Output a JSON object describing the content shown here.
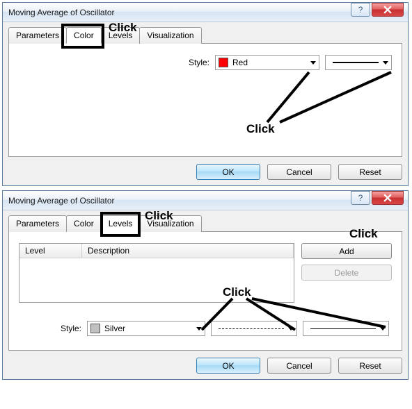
{
  "dialog1": {
    "title": "Moving Average of Oscillator",
    "tabs": {
      "parameters": "Parameters",
      "color": "Color",
      "levels": "Levels",
      "visualization": "Visualization"
    },
    "style_label": "Style:",
    "color_name": "Red",
    "color_hex": "#ff0000",
    "ok": "OK",
    "cancel": "Cancel",
    "reset": "Reset"
  },
  "dialog2": {
    "title": "Moving Average of Oscillator",
    "tabs": {
      "parameters": "Parameters",
      "color": "Color",
      "levels": "Levels",
      "visualization": "Visualization"
    },
    "level_header": "Level",
    "desc_header": "Description",
    "add": "Add",
    "delete": "Delete",
    "style_label": "Style:",
    "color_name": "Silver",
    "color_hex": "#c0c0c0",
    "ok": "OK",
    "cancel": "Cancel",
    "reset": "Reset"
  },
  "annotations": {
    "click": "Click"
  }
}
